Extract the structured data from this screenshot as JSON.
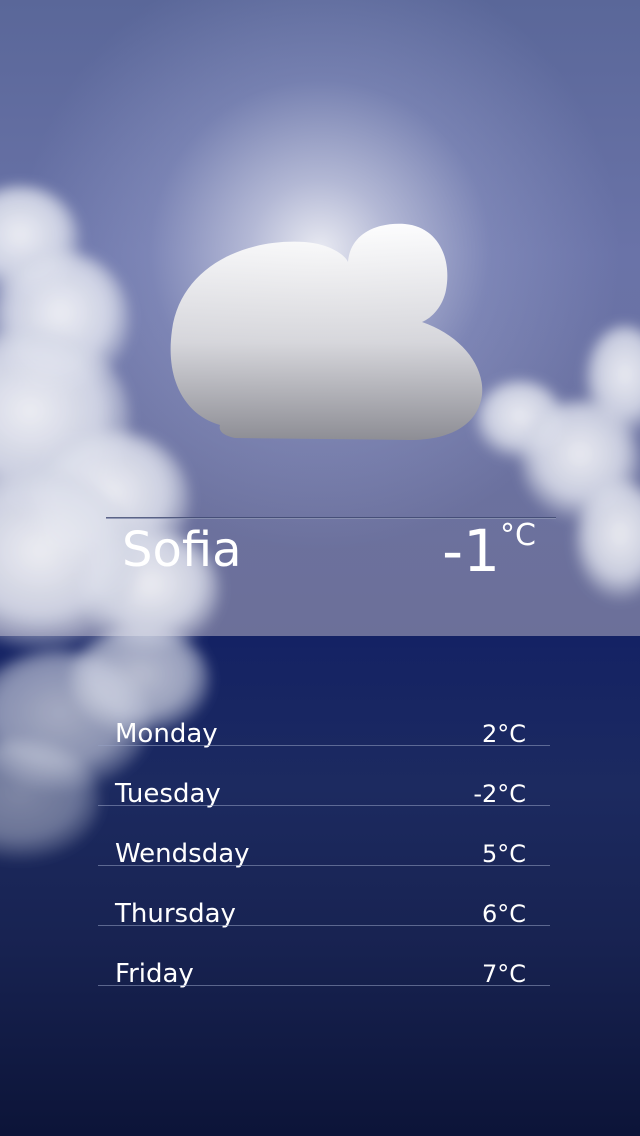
{
  "current": {
    "city": "Sofia",
    "temperature": "-1",
    "unit": "°C",
    "condition_icon": "cloud-icon"
  },
  "forecast": [
    {
      "day": "Monday",
      "temp": "2°C"
    },
    {
      "day": "Tuesday",
      "temp": "-2°C"
    },
    {
      "day": "Wendsday",
      "temp": "5°C"
    },
    {
      "day": "Thursday",
      "temp": "6°C"
    },
    {
      "day": "Friday",
      "temp": "7°C"
    }
  ],
  "colors": {
    "top_panel": "#6a73a6",
    "bottom_panel": "#1a2758",
    "text": "#ffffff"
  }
}
